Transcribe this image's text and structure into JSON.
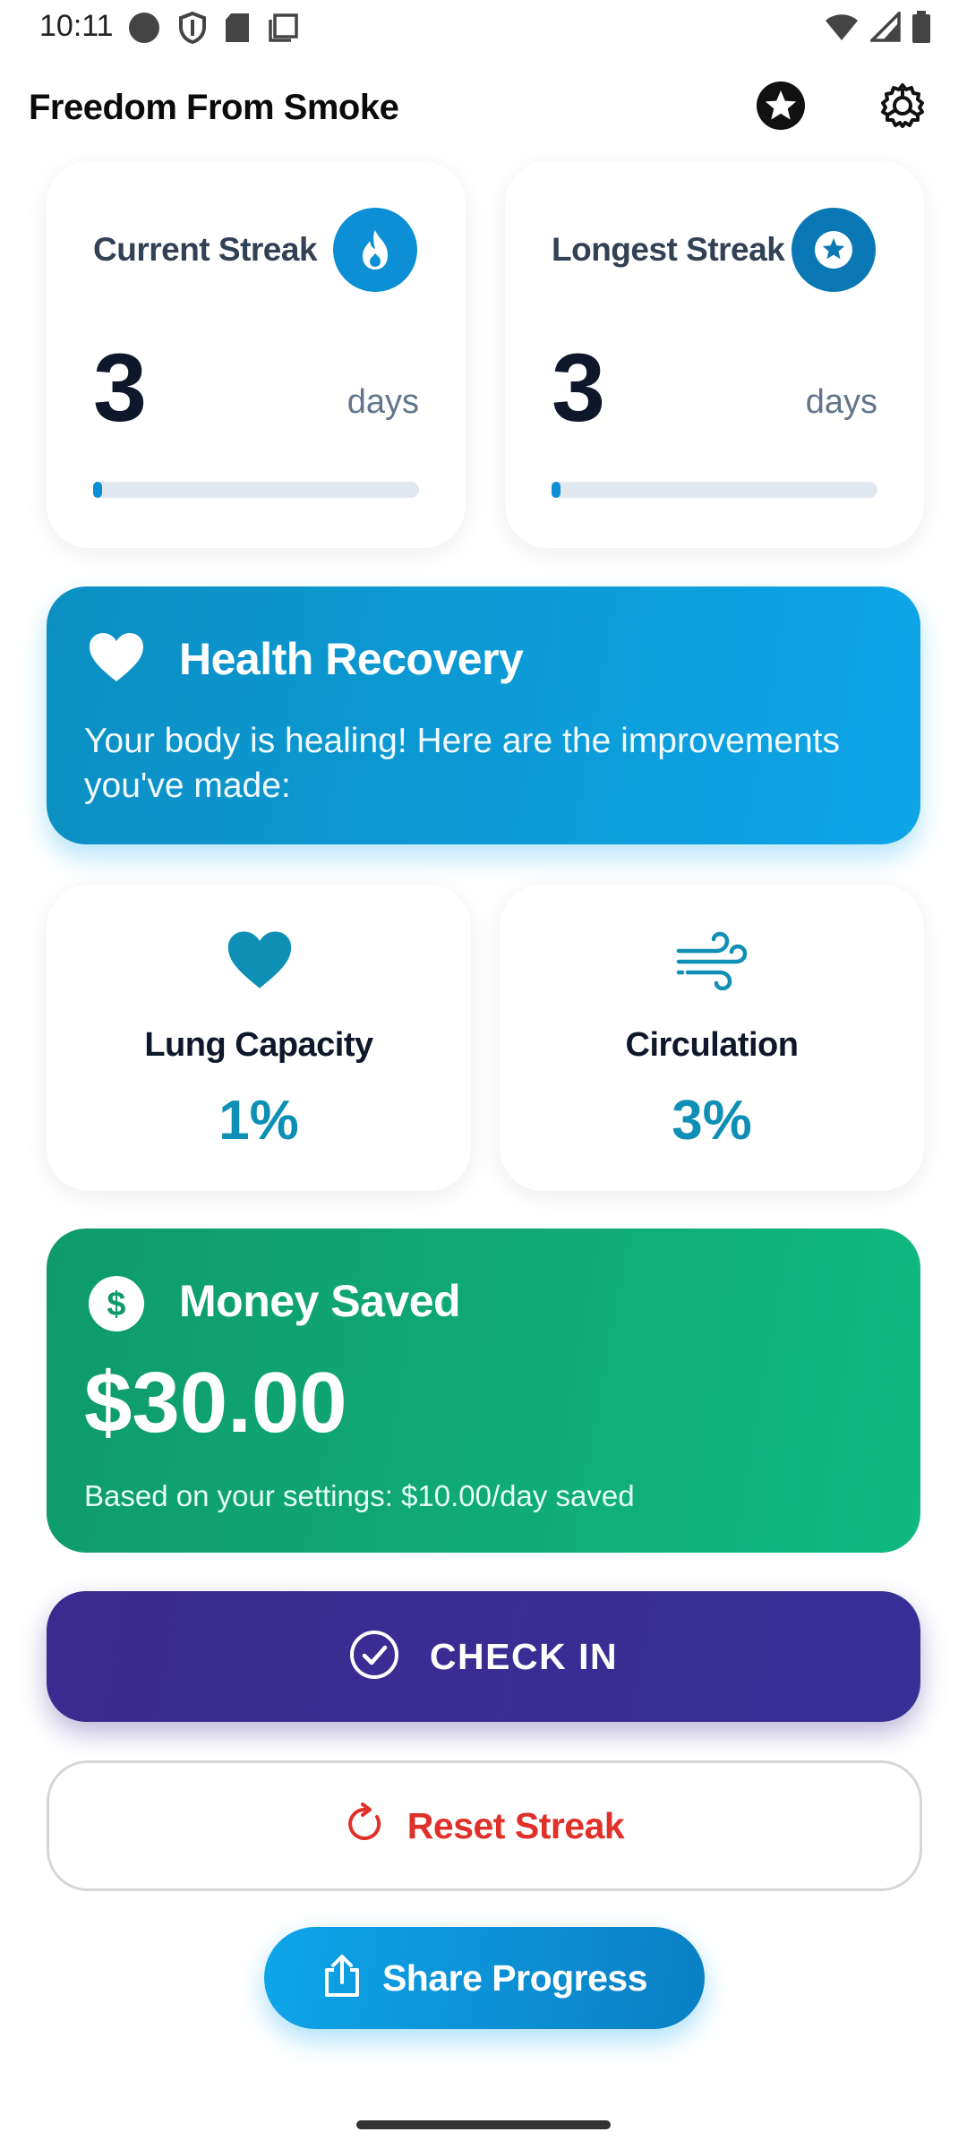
{
  "status_bar": {
    "time": "10:11",
    "icons": [
      "record-icon",
      "shield-icon",
      "sd-card-icon",
      "screenshot-icon",
      "wifi-icon",
      "signal-icon",
      "battery-icon"
    ]
  },
  "app_bar": {
    "title": "Freedom From Smoke",
    "actions": [
      "star-badge-icon",
      "settings-icon"
    ]
  },
  "streaks": {
    "current": {
      "title": "Current Streak",
      "value": "3",
      "unit": "days",
      "progress": 0.01,
      "icon": "flame-icon"
    },
    "longest": {
      "title": "Longest Streak",
      "value": "3",
      "unit": "days",
      "progress": 0.01,
      "icon": "star-icon"
    }
  },
  "health": {
    "title": "Health Recovery",
    "subtitle": "Your body is healing! Here are the improvements you've made:",
    "icon": "heart-icon",
    "stats": [
      {
        "label": "Lung Capacity",
        "value": "1%",
        "icon": "heart-icon"
      },
      {
        "label": "Circulation",
        "value": "3%",
        "icon": "wind-icon"
      }
    ]
  },
  "money": {
    "title": "Money Saved",
    "amount": "$30.00",
    "note": "Based on your settings: $10.00/day saved",
    "icon": "dollar-icon"
  },
  "actions": {
    "check_in": "CHECK IN",
    "reset": "Reset Streak",
    "share": "Share Progress"
  },
  "colors": {
    "primary_blue": "#0ea5e9",
    "teal": "#0e8fb5",
    "green": "#10b981",
    "purple": "#3b2a8f",
    "danger": "#e0302a"
  }
}
